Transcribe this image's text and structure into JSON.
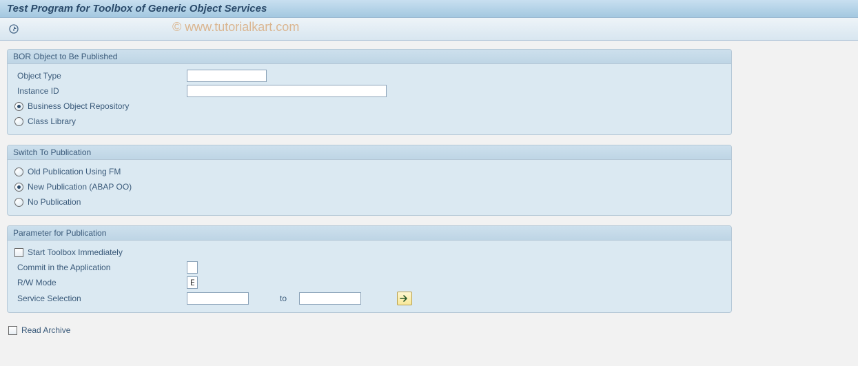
{
  "title": "Test Program for Toolbox of Generic Object Services",
  "watermark": "© www.tutorialkart.com",
  "group1": {
    "title": "BOR Object to Be Published",
    "object_type_label": "Object Type",
    "object_type_value": "",
    "instance_id_label": "Instance ID",
    "instance_id_value": "",
    "radio_bor": "Business Object Repository",
    "radio_class": "Class Library"
  },
  "group2": {
    "title": "Switch To Publication",
    "radio_old": "Old Publication Using FM",
    "radio_new": "New Publication (ABAP OO)",
    "radio_none": "No Publication"
  },
  "group3": {
    "title": "Parameter for Publication",
    "chk_start": "Start Toolbox Immediately",
    "commit_label": "Commit in the Application",
    "commit_value": "",
    "rw_label": "R/W Mode",
    "rw_value": "E",
    "service_label": "Service Selection",
    "service_from": "",
    "service_to_label": "to",
    "service_to": ""
  },
  "read_archive_label": "Read Archive"
}
